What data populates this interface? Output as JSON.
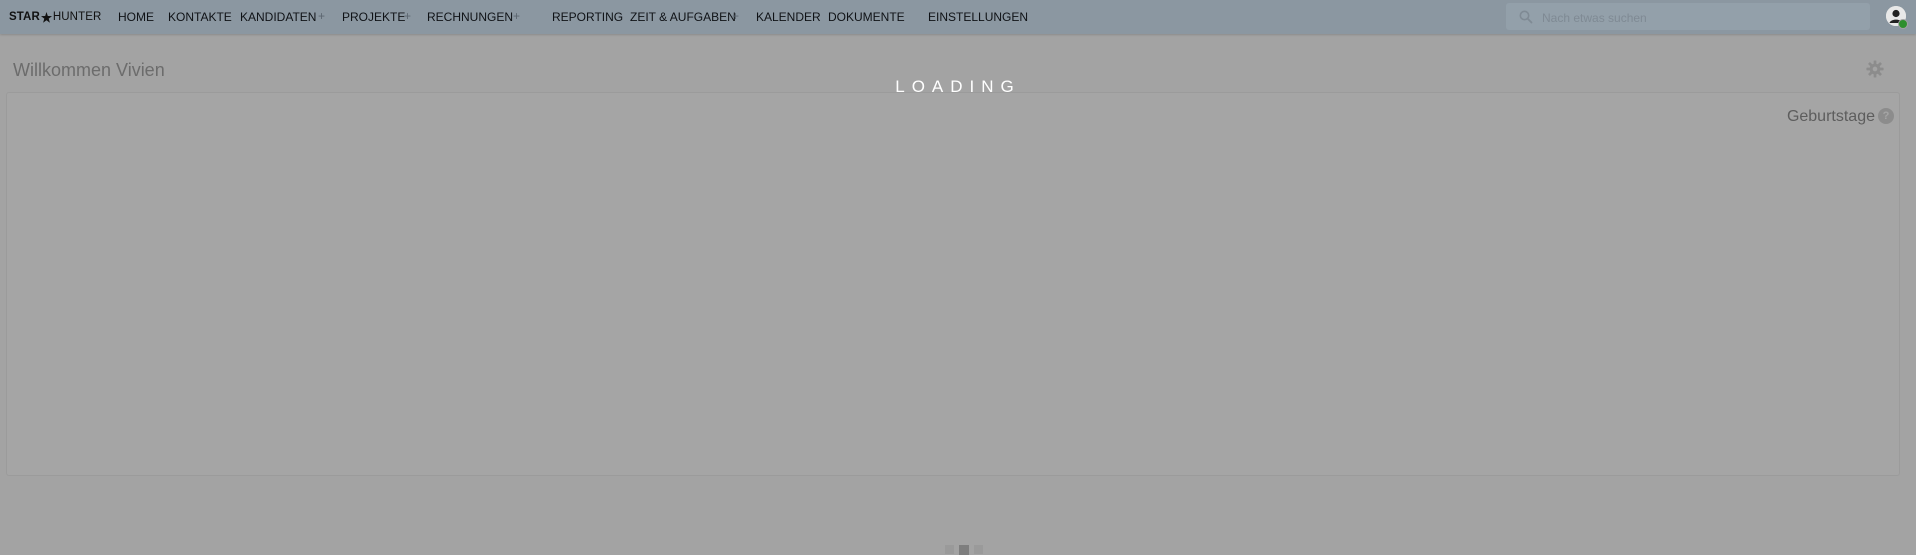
{
  "app": {
    "logo_left": "STAR",
    "logo_right": "HUNTER",
    "logo_icon": "star-icon"
  },
  "nav": {
    "items": [
      {
        "label": "HOME"
      },
      {
        "label": "KONTAKTE"
      },
      {
        "label": "KANDIDATEN",
        "plus": true
      },
      {
        "label": "PROJEKTE",
        "plus": true
      },
      {
        "label": "RECHNUNGEN",
        "plus": true
      },
      {
        "label": "REPORTING"
      },
      {
        "label": "ZEIT & AUFGABEN",
        "plus": true
      },
      {
        "label": "KALENDER"
      },
      {
        "label": "DOKUMENTE"
      },
      {
        "label": "EINSTELLUNGEN"
      }
    ],
    "plus_symbol": "+"
  },
  "search": {
    "placeholder": "Nach etwas suchen",
    "icon": "search-icon"
  },
  "user": {
    "avatar_icon": "user-avatar-icon",
    "status": "online",
    "status_color": "#2e8f2e"
  },
  "page": {
    "title": "Willkommen Vivien",
    "settings_icon": "gear-icon"
  },
  "widget": {
    "title": "Geburtstage",
    "help_symbol": "?"
  },
  "overlay": {
    "text": "LOADING"
  },
  "colors": {
    "topbar": "#8b97a1",
    "overlay_background": "#a3a3a3"
  }
}
